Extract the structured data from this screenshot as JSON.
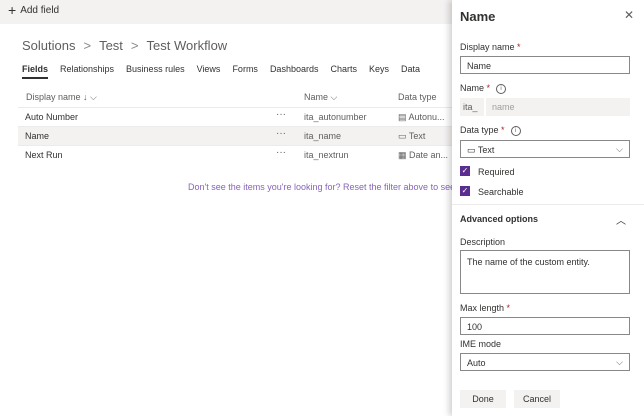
{
  "commandbar": {
    "add_field": "Add field"
  },
  "breadcrumb": {
    "items": [
      "Solutions",
      "Test",
      "Test Workflow"
    ],
    "separator": ">"
  },
  "tabs": [
    "Fields",
    "Relationships",
    "Business rules",
    "Views",
    "Forms",
    "Dashboards",
    "Charts",
    "Keys",
    "Data"
  ],
  "table": {
    "columns": {
      "display_name": "Display name ↓",
      "name": "Name",
      "data_type": "Data type"
    },
    "rows": [
      {
        "display_name": "Auto Number",
        "more": "···",
        "name": "ita_autonumber",
        "type_icon": "autonumber-icon",
        "data_type": "Autonu..."
      },
      {
        "display_name": "Name",
        "more": "···",
        "name": "ita_name",
        "type_icon": "text-icon",
        "data_type": "Text"
      },
      {
        "display_name": "Next Run",
        "more": "···",
        "name": "ita_nextrun",
        "type_icon": "calendar-icon",
        "data_type": "Date an..."
      }
    ],
    "note": "Don't see the items you're looking for? Reset the filter above to see more"
  },
  "panel": {
    "title": "Name",
    "display_name_label": "Display name",
    "display_name_value": "Name",
    "name_label": "Name",
    "name_prefix": "ita_",
    "name_placeholder": "name",
    "data_type_label": "Data type",
    "data_type_value": "Text",
    "required_label": "Required",
    "searchable_label": "Searchable",
    "advanced_label": "Advanced options",
    "description_label": "Description",
    "description_value": "The name of the custom entity.",
    "max_length_label": "Max length",
    "max_length_value": "100",
    "ime_label": "IME mode",
    "ime_value": "Auto",
    "done_button": "Done",
    "cancel_button": "Cancel",
    "required_mark": "*"
  },
  "colors": {
    "accent": "#5c2d91",
    "note": "#8764b8"
  }
}
